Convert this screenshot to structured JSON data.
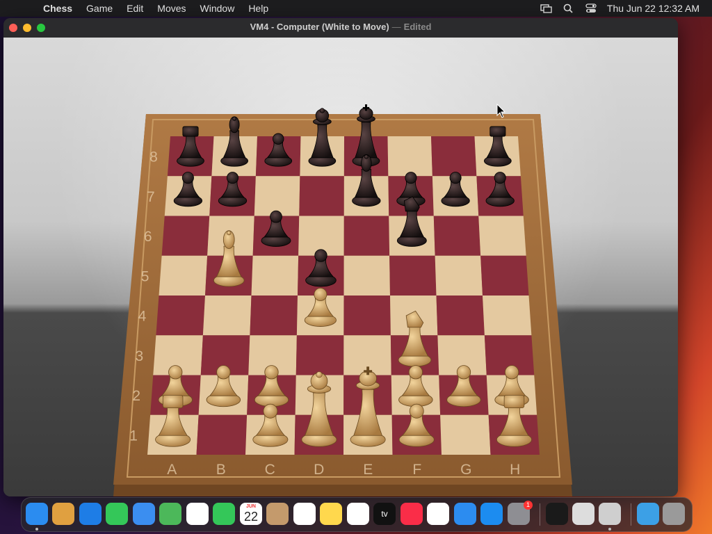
{
  "menubar": {
    "app": "Chess",
    "items": [
      "Game",
      "Edit",
      "Moves",
      "Window",
      "Help"
    ],
    "clock": "Thu Jun 22  12:32 AM"
  },
  "window": {
    "title": "VM4 - Computer   (White to Move)",
    "separator": "—",
    "status": "Edited"
  },
  "board": {
    "files": [
      "A",
      "B",
      "C",
      "D",
      "E",
      "F",
      "G",
      "H"
    ],
    "ranks": [
      "1",
      "2",
      "3",
      "4",
      "5",
      "6",
      "7",
      "8"
    ],
    "light_color": "#e4c9a0",
    "dark_color": "#8a2d3b",
    "frame_color": "#a06a3a",
    "pieces": [
      {
        "sq": "a8",
        "color": "black",
        "type": "rook"
      },
      {
        "sq": "b8",
        "color": "black",
        "type": "bishop"
      },
      {
        "sq": "c8",
        "color": "black",
        "type": "pawn"
      },
      {
        "sq": "d8",
        "color": "black",
        "type": "queen"
      },
      {
        "sq": "e8",
        "color": "black",
        "type": "king"
      },
      {
        "sq": "h8",
        "color": "black",
        "type": "rook"
      },
      {
        "sq": "a7",
        "color": "black",
        "type": "pawn"
      },
      {
        "sq": "b7",
        "color": "black",
        "type": "pawn"
      },
      {
        "sq": "e7",
        "color": "black",
        "type": "bishop"
      },
      {
        "sq": "f7",
        "color": "black",
        "type": "pawn"
      },
      {
        "sq": "g7",
        "color": "black",
        "type": "pawn"
      },
      {
        "sq": "h7",
        "color": "black",
        "type": "pawn"
      },
      {
        "sq": "c6",
        "color": "black",
        "type": "pawn"
      },
      {
        "sq": "f6",
        "color": "black",
        "type": "knight"
      },
      {
        "sq": "d5",
        "color": "black",
        "type": "pawn"
      },
      {
        "sq": "b5",
        "color": "white",
        "type": "bishop"
      },
      {
        "sq": "d4",
        "color": "white",
        "type": "pawn"
      },
      {
        "sq": "f3",
        "color": "white",
        "type": "knight"
      },
      {
        "sq": "a2",
        "color": "white",
        "type": "pawn"
      },
      {
        "sq": "b2",
        "color": "white",
        "type": "pawn"
      },
      {
        "sq": "c2",
        "color": "white",
        "type": "pawn"
      },
      {
        "sq": "f2",
        "color": "white",
        "type": "pawn"
      },
      {
        "sq": "g2",
        "color": "white",
        "type": "pawn"
      },
      {
        "sq": "h2",
        "color": "white",
        "type": "pawn"
      },
      {
        "sq": "a1",
        "color": "white",
        "type": "rook"
      },
      {
        "sq": "c1",
        "color": "white",
        "type": "pawn"
      },
      {
        "sq": "d1",
        "color": "white",
        "type": "queen"
      },
      {
        "sq": "e1",
        "color": "white",
        "type": "king"
      },
      {
        "sq": "f1",
        "color": "white",
        "type": "pawn"
      },
      {
        "sq": "h1",
        "color": "white",
        "type": "rook"
      }
    ]
  },
  "dock": {
    "calendar_month": "JUN",
    "calendar_day": "22",
    "tv_label": "tv",
    "settings_badge": "1",
    "apps": [
      {
        "name": "finder",
        "color": "#2b8cf0"
      },
      {
        "name": "launchpad",
        "color": "#e0a040"
      },
      {
        "name": "safari",
        "color": "#1e7de6"
      },
      {
        "name": "messages",
        "color": "#34c759"
      },
      {
        "name": "mail",
        "color": "#3b8ef0"
      },
      {
        "name": "maps",
        "color": "#4cb85a"
      },
      {
        "name": "photos",
        "color": "#ffffff"
      },
      {
        "name": "facetime",
        "color": "#34c759"
      },
      {
        "name": "calendar",
        "color": "#ffffff"
      },
      {
        "name": "contacts",
        "color": "#c49a6c"
      },
      {
        "name": "reminders",
        "color": "#ffffff"
      },
      {
        "name": "notes",
        "color": "#ffd84d"
      },
      {
        "name": "freeform",
        "color": "#ffffff"
      },
      {
        "name": "tv",
        "color": "#111111"
      },
      {
        "name": "music",
        "color": "#fa2d48"
      },
      {
        "name": "news",
        "color": "#ffffff"
      },
      {
        "name": "keynote",
        "color": "#2c8cf0"
      },
      {
        "name": "app-store",
        "color": "#1c8cf0"
      },
      {
        "name": "system-settings",
        "color": "#8e8e93"
      },
      {
        "name": "activity-monitor",
        "color": "#1a1a1a"
      },
      {
        "name": "automator",
        "color": "#dddddd"
      },
      {
        "name": "chess",
        "color": "#cfcfcf"
      },
      {
        "name": "downloads-folder",
        "color": "#3ca0e6"
      },
      {
        "name": "trash",
        "color": "#9a9a9a"
      }
    ]
  }
}
